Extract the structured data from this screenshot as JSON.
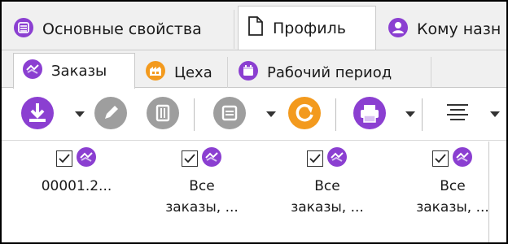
{
  "window_tabs": [
    {
      "label": "Основные свойства",
      "icon": "list-icon",
      "active": false
    },
    {
      "label": "Профиль",
      "icon": "document-icon",
      "active": true
    },
    {
      "label": "Кому назн",
      "icon": "user-icon",
      "active": false
    }
  ],
  "sub_tabs": [
    {
      "label": "Заказы",
      "icon": "orders-icon",
      "active": true
    },
    {
      "label": "Цеха",
      "icon": "workshop-icon",
      "active": false
    },
    {
      "label": "Рабочий период",
      "icon": "calendar-icon",
      "active": false
    }
  ],
  "toolbar": {
    "buttons": [
      {
        "name": "download-button",
        "icon": "download-icon",
        "enabled": true,
        "dropdown": true
      },
      {
        "name": "edit-button",
        "icon": "pencil-icon",
        "enabled": false,
        "dropdown": false
      },
      {
        "name": "delete-button",
        "icon": "trash-icon",
        "enabled": false,
        "dropdown": false
      },
      {
        "name": "copy-button",
        "icon": "copy-icon",
        "enabled": false,
        "dropdown": true
      },
      {
        "name": "refresh-button",
        "icon": "refresh-icon",
        "enabled": true,
        "dropdown": false
      },
      {
        "name": "print-button",
        "icon": "printer-icon",
        "enabled": true,
        "dropdown": true
      },
      {
        "name": "align-button",
        "icon": "align-icon",
        "enabled": true,
        "dropdown": true
      }
    ]
  },
  "items": [
    {
      "label": "00001.2...",
      "checked": true
    },
    {
      "label": "Все\nзаказы, ...",
      "checked": true
    },
    {
      "label": "Все\nзаказы, ...",
      "checked": true
    },
    {
      "label": "Все\nзаказы, ...",
      "checked": true
    }
  ],
  "colors": {
    "purple": "#8b3fd1",
    "orange": "#f39a1e",
    "gray_disabled": "#9e9e9e"
  }
}
